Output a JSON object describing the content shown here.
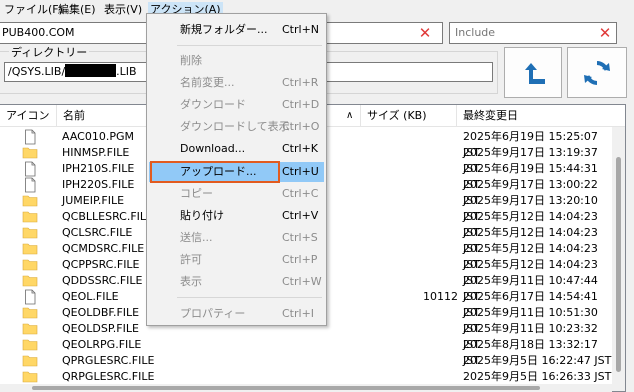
{
  "menubar": [
    {
      "label": "ファイル(F)"
    },
    {
      "label": "編集(E)"
    },
    {
      "label": "表示(V)"
    },
    {
      "label": "アクション(A)"
    }
  ],
  "host": {
    "value": "PUB400.COM"
  },
  "filter": {
    "placeholder": "Include"
  },
  "directory": {
    "label": "ディレクトリー",
    "prefix": "/QSYS.LIB/",
    "suffix": ".LIB"
  },
  "columns": {
    "icon": "アイコン",
    "name": "名前",
    "size": "サイズ (KB)",
    "modified": "最終変更日"
  },
  "files": [
    {
      "type": "file",
      "name": "AAC010.PGM",
      "size": "",
      "date": "2025年6月19日  15:25:07 JST"
    },
    {
      "type": "folder",
      "name": "HINMSP.FILE",
      "size": "",
      "date": "2025年9月17日  13:19:37 JST"
    },
    {
      "type": "file",
      "name": "IPH210S.FILE",
      "size": "",
      "date": "2025年6月19日  15:44:31 JST"
    },
    {
      "type": "file",
      "name": "IPH220S.FILE",
      "size": "",
      "date": "2025年9月17日  13:00:22 JST"
    },
    {
      "type": "folder",
      "name": "JUMEIP.FILE",
      "size": "",
      "date": "2025年9月17日  13:20:10 JST"
    },
    {
      "type": "folder",
      "name": "QCBLLESRC.FILE",
      "size": "",
      "date": "2025年5月12日  14:04:23 JST"
    },
    {
      "type": "folder",
      "name": "QCLSRC.FILE",
      "size": "",
      "date": "2025年5月12日  14:04:23 JST"
    },
    {
      "type": "folder",
      "name": "QCMDSRC.FILE",
      "size": "",
      "date": "2025年5月12日  14:04:23 JST"
    },
    {
      "type": "folder",
      "name": "QCPPSRC.FILE",
      "size": "",
      "date": "2025年5月12日  14:04:23 JST"
    },
    {
      "type": "folder",
      "name": "QDDSSRC.FILE",
      "size": "",
      "date": "2025年9月11日  10:47:44 JST"
    },
    {
      "type": "file",
      "name": "QEOL.FILE",
      "size": "10112",
      "date": "2025年6月17日  14:54:41 JST"
    },
    {
      "type": "folder",
      "name": "QEOLDBF.FILE",
      "size": "",
      "date": "2025年9月11日  10:51:30 JST"
    },
    {
      "type": "folder",
      "name": "QEOLDSP.FILE",
      "size": "",
      "date": "2025年9月11日  10:23:32 JST"
    },
    {
      "type": "folder",
      "name": "QEOLRPG.FILE",
      "size": "",
      "date": "2025年8月18日  13:32:17 JST"
    },
    {
      "type": "folder",
      "name": "QPRGLESRC.FILE",
      "size": "",
      "date": "2025年9月5日  16:22:47 JST"
    },
    {
      "type": "folder",
      "name": "QRPGLESRC.FILE",
      "size": "",
      "date": "2025年9月5日  16:26:33 JST"
    }
  ],
  "context_menu": [
    {
      "label": "新規フォルダー...",
      "shortcut": "Ctrl+N",
      "enabled": true
    },
    {
      "label": "削除",
      "shortcut": "",
      "enabled": false
    },
    {
      "label": "名前変更...",
      "shortcut": "Ctrl+R",
      "enabled": false
    },
    {
      "label": "ダウンロード",
      "shortcut": "Ctrl+D",
      "enabled": false
    },
    {
      "label": "ダウンロードして表示",
      "shortcut": "Ctrl+O",
      "enabled": false
    },
    {
      "label": "Download...",
      "shortcut": "Ctrl+K",
      "enabled": true
    },
    {
      "label": "アップロード...",
      "shortcut": "Ctrl+U",
      "enabled": true,
      "highlighted": true
    },
    {
      "label": "コピー",
      "shortcut": "Ctrl+C",
      "enabled": false
    },
    {
      "label": "貼り付け",
      "shortcut": "Ctrl+V",
      "enabled": true
    },
    {
      "label": "送信...",
      "shortcut": "Ctrl+S",
      "enabled": false
    },
    {
      "label": "許可",
      "shortcut": "Ctrl+P",
      "enabled": false
    },
    {
      "label": "表示",
      "shortcut": "Ctrl+W",
      "enabled": false
    },
    {
      "label": "プロパティー",
      "shortcut": "Ctrl+I",
      "enabled": false
    }
  ],
  "icons": {
    "folder_color": "#ffd766",
    "clear_color": "#e03a3a",
    "button_icon_color": "#1f6fb5",
    "highlight_border": "#e25b1f"
  }
}
